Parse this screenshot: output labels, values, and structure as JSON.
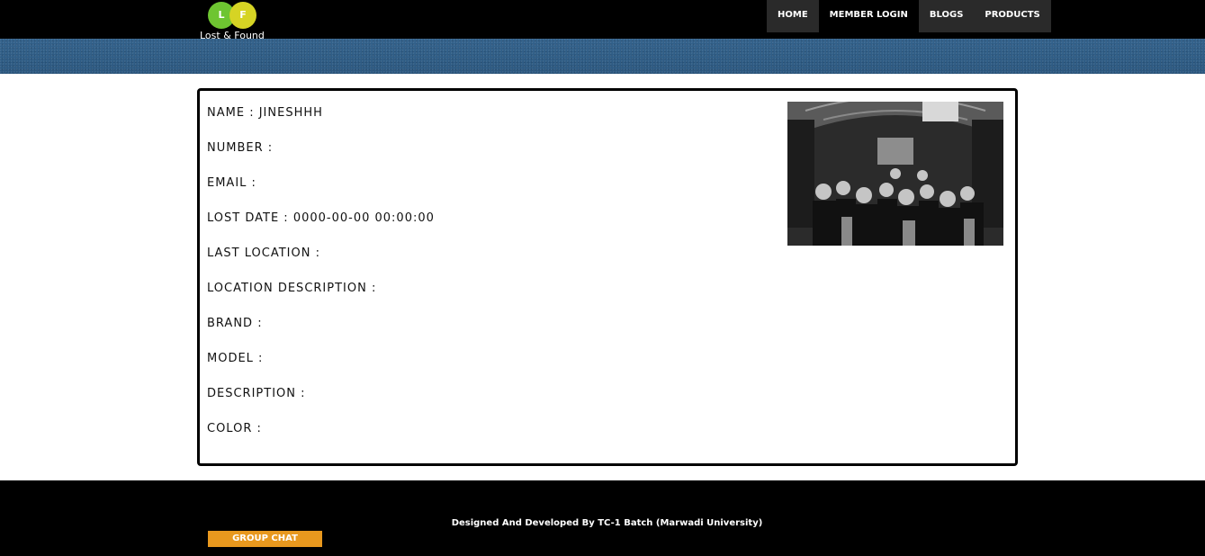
{
  "header": {
    "logo": {
      "letter1": "L",
      "letter2": "F",
      "text": "Lost & Found"
    },
    "nav": [
      {
        "label": "HOME"
      },
      {
        "label": "MEMBER LOGIN"
      },
      {
        "label": "BLOGS"
      },
      {
        "label": "PRODUCTS"
      }
    ]
  },
  "details": {
    "fields": [
      {
        "label": "NAME",
        "value": "JINESHHH"
      },
      {
        "label": "NUMBER",
        "value": ""
      },
      {
        "label": "EMAIL",
        "value": ""
      },
      {
        "label": "LOST DATE",
        "value": "0000-00-00 00:00:00"
      },
      {
        "label": "LAST LOCATION",
        "value": ""
      },
      {
        "label": "LOCATION DESCRIPTION",
        "value": ""
      },
      {
        "label": "BRAND",
        "value": ""
      },
      {
        "label": "MODEL",
        "value": ""
      },
      {
        "label": "DESCRIPTION",
        "value": ""
      },
      {
        "label": "COLOR",
        "value": ""
      }
    ]
  },
  "footer": {
    "credit": "Designed And Developed By TC-1 Batch (Marwadi University)",
    "chat_button": "GROUP CHAT"
  },
  "colors": {
    "band": "#2f5d85",
    "chat_button": "#e8981e",
    "logo_green": "#6ec531",
    "logo_yellow": "#d6d424"
  }
}
